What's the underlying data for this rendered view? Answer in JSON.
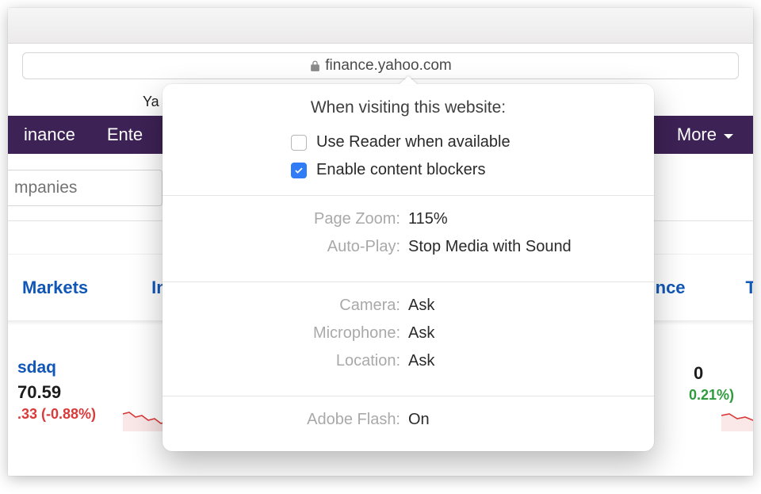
{
  "address_bar": {
    "url": "finance.yahoo.com"
  },
  "yahoo_menu_partial": "Ya",
  "yahoo_nav": {
    "item_finance": "inance",
    "item_ente": "Ente",
    "item_more": "More"
  },
  "search_placeholder_partial": "mpanies",
  "tabs": {
    "markets": "Markets",
    "partial_in": "In",
    "partial_nce": "nce",
    "partial_t": "T"
  },
  "indices": {
    "left": {
      "name_partial": "sdaq",
      "price_partial": "70.59",
      "change_partial": ".33 (-0.88%)"
    },
    "right": {
      "price_partial": "0",
      "change_partial": "0.21%)"
    }
  },
  "popover": {
    "title": "When visiting this website:",
    "reader_label": "Use Reader when available",
    "reader_checked": false,
    "blockers_label": "Enable content blockers",
    "blockers_checked": true,
    "rows": {
      "zoom_label": "Page Zoom:",
      "zoom_value": "115%",
      "autoplay_label": "Auto-Play:",
      "autoplay_value": "Stop Media with Sound",
      "camera_label": "Camera:",
      "camera_value": "Ask",
      "mic_label": "Microphone:",
      "mic_value": "Ask",
      "location_label": "Location:",
      "location_value": "Ask",
      "flash_label": "Adobe Flash:",
      "flash_value": "On"
    }
  }
}
